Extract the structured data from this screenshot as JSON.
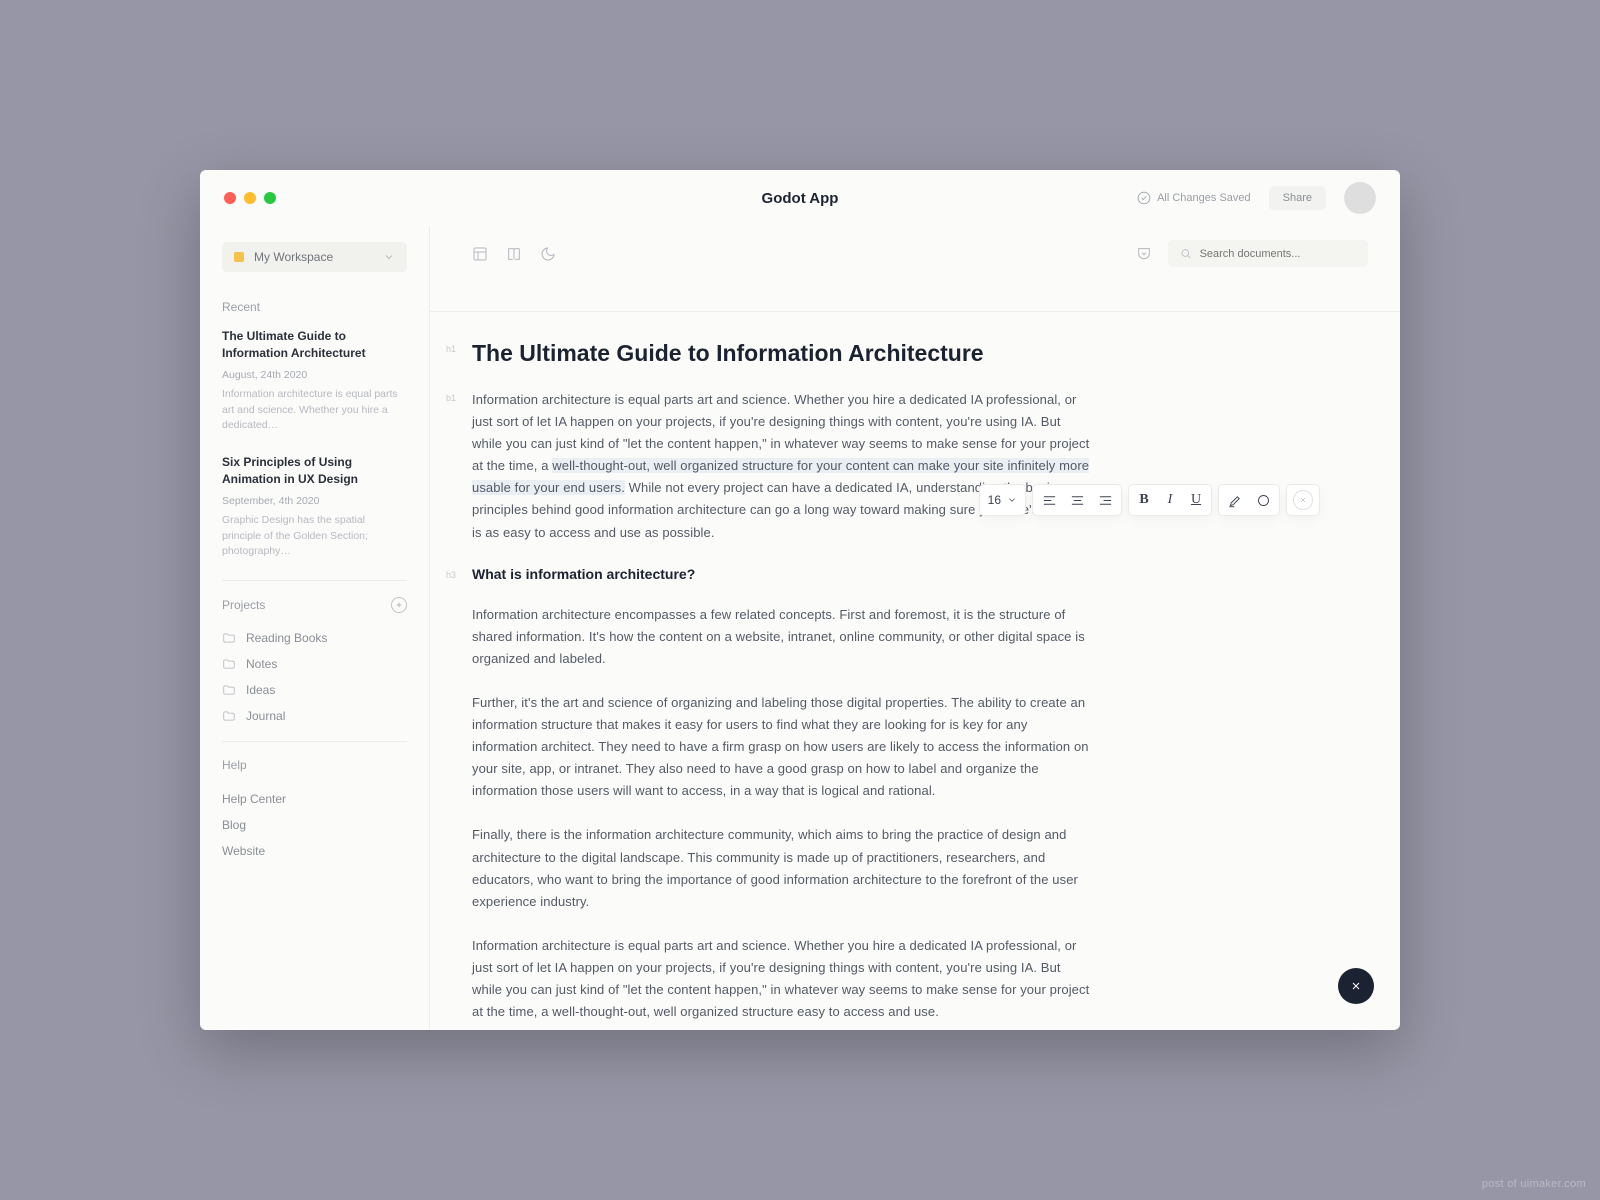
{
  "app": {
    "title": "Godot App"
  },
  "header": {
    "saved_label": "All Changes Saved",
    "share_label": "Share"
  },
  "sidebar": {
    "workspace_label": "My Workspace",
    "recent_label": "Recent",
    "recent": [
      {
        "title": "The Ultimate Guide to Information Architecturet",
        "date": "August, 24th 2020",
        "snippet": "Information architecture is equal parts art and science. Whether you hire a dedicated…"
      },
      {
        "title": "Six Principles of Using Animation in UX Design",
        "date": "September, 4th 2020",
        "snippet": "Graphic Design has the spatial principle of the Golden Section; photography…"
      }
    ],
    "projects_label": "Projects",
    "projects": [
      "Reading Books",
      "Notes",
      "Ideas",
      "Journal"
    ],
    "help_label": "Help",
    "help_links": [
      "Help Center",
      "Blog",
      "Website"
    ]
  },
  "editor": {
    "search_placeholder": "Search documents...",
    "blocks": {
      "title": {
        "tag": "h1",
        "text": "The Ultimate Guide to Information Architecture"
      },
      "p1": {
        "tag": "b1",
        "pre": "Information architecture is equal parts art and science. Whether you hire a dedicated IA professional, or just sort of let IA happen on your projects, if you're designing things with content, you're using IA. But while you can just kind of \"let the content happen,\" in whatever way seems to make sense for your project at the time, a ",
        "highlight": "well-thought-out, well organized structure for your content can make your site infinitely more usable for your end users.",
        "post": " While not every project can have a dedicated IA, understanding the basic principles behind good information architecture can go a long way toward making sure your site's content is as easy to access and use as possible."
      },
      "h3": {
        "tag": "h3",
        "text": "What is information architecture?"
      },
      "p2": "Information architecture encompasses a few related concepts. First and foremost, it is the structure of shared information. It's how the content on a website, intranet, online community, or other digital space is organized and labeled.",
      "p3": "Further, it's the art and science of organizing and labeling those digital properties. The ability to create an information structure that makes it easy for users to find what they are looking for is key for any information architect. They need to have a firm grasp on how users are likely to access the information on your site, app, or intranet. They also need to have a good grasp on how to label and organize the information those users will want to access, in a way that is logical and rational.",
      "p4": "Finally, there is the information architecture community, which aims to bring the practice of design and architecture to the digital landscape. This community is made up of practitioners, researchers, and educators, who want to bring the importance of good information architecture to the forefront of the user experience industry.",
      "p5": "Information architecture is equal parts art and science. Whether you hire a dedicated IA professional, or just sort of let IA happen on your projects, if you're designing things with content, you're using IA. But while you can just kind of \"let the content happen,\" in whatever way seems to make sense for your project at the time, a well-thought-out, well organized structure easy to access and use."
    },
    "font_size": "16"
  },
  "watermark": "post of uimaker.com"
}
